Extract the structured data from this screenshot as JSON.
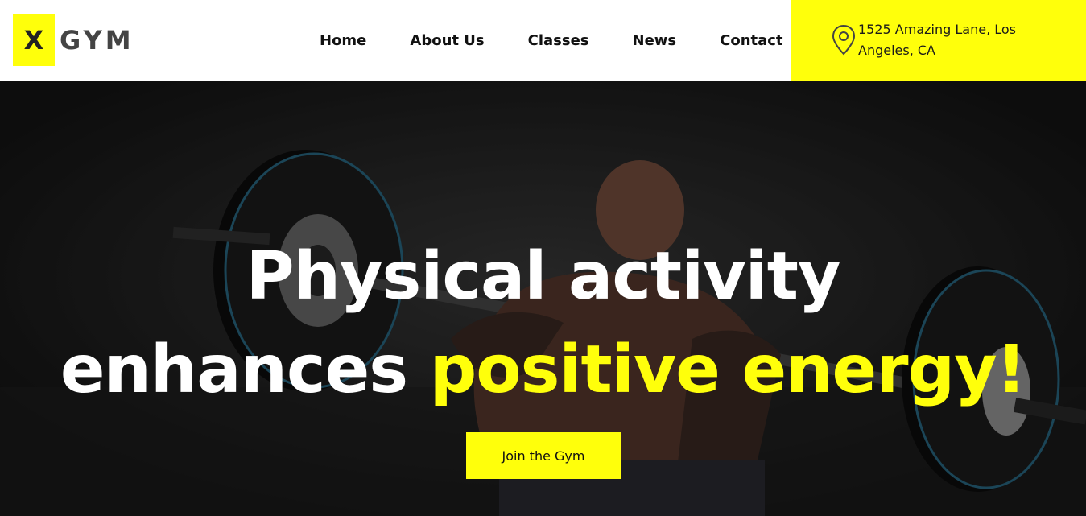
{
  "brand": {
    "logo_mark": "X",
    "logo_text": "GYM",
    "accent_color": "#ffff0b"
  },
  "nav": {
    "items": [
      {
        "label": "Home"
      },
      {
        "label": "About Us"
      },
      {
        "label": "Classes"
      },
      {
        "label": "News"
      },
      {
        "label": "Contact"
      }
    ]
  },
  "address": {
    "icon": "map-pin-icon",
    "line1": "1525 Amazing Lane, Los",
    "line2": "Angeles, CA"
  },
  "hero": {
    "headline_line1": "Physical activity",
    "headline_line2_plain": "enhances",
    "headline_line2_accent": "positive energy!",
    "cta_label": "Join the Gym",
    "background": "weightlifter-barbell-photo"
  }
}
